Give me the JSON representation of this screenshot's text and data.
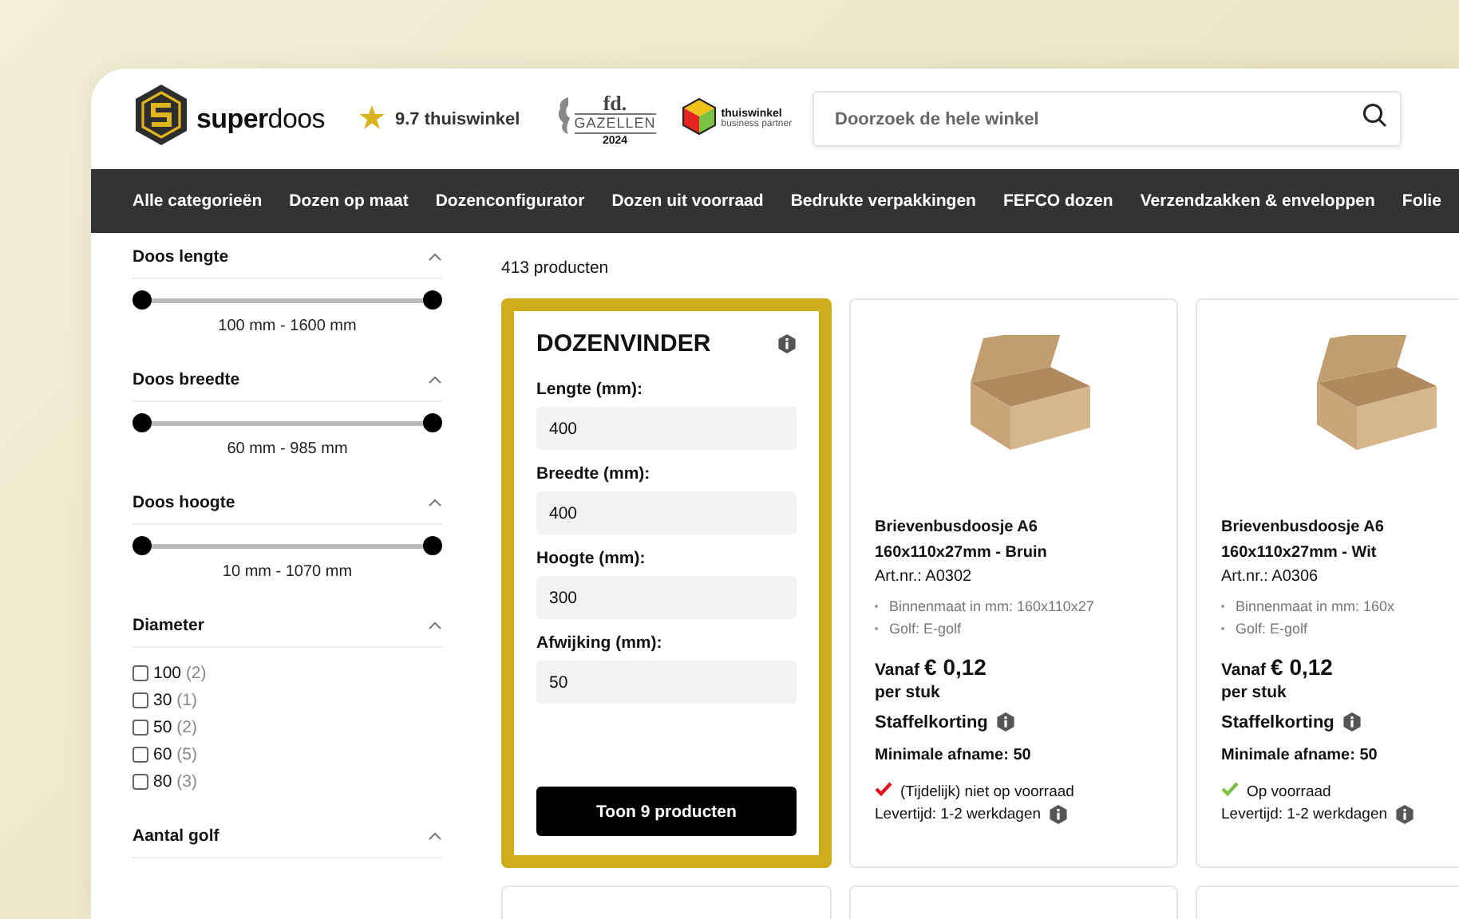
{
  "header": {
    "logo": "**super**doos",
    "rating": "9.7 thuiswinkel",
    "award": {
      "brand": "fd.",
      "title": "GAZELLEN",
      "year": "2024"
    },
    "partner": {
      "name": "thuiswinkel",
      "subtitle": "business partner"
    },
    "search": {
      "placeholder": "Doorzoek de hele winkel"
    }
  },
  "nav": [
    "Alle categorieën",
    "Dozen op maat",
    "Dozenconfigurator",
    "Dozen uit voorraad",
    "Bedrukte verpakkingen",
    "FEFCO dozen",
    "Verzendzakken & enveloppen",
    "Folie"
  ],
  "filters": [
    {
      "kind": "range",
      "title": "Doos lengte",
      "expanded": true,
      "range": "100 mm - 1600 mm",
      "level": 1
    },
    {
      "kind": "range",
      "title": "Doos breedte",
      "expanded": true,
      "range": "60 mm - 985 mm",
      "level": 1
    },
    {
      "kind": "range",
      "title": "Doos hoogte",
      "expanded": true,
      "range": "10 mm - 1070 mm",
      "level": 1
    },
    {
      "kind": "checklist",
      "title": "Diameter",
      "expanded": true,
      "options": [
        {
          "label": "100",
          "count": "(2)",
          "checked": false
        },
        {
          "label": "30",
          "count": "(1)",
          "checked": false
        },
        {
          "label": "50",
          "count": "(2)",
          "checked": false
        },
        {
          "label": "60",
          "count": "(5)",
          "checked": false
        },
        {
          "label": "80",
          "count": "(3)",
          "checked": false
        }
      ]
    },
    {
      "kind": "checklist",
      "title": "Aantal golf",
      "expanded": true
    }
  ],
  "results": {
    "count": "413 producten"
  },
  "finder": {
    "title": "DOZENVINDER",
    "fields": [
      {
        "label": "Lengte (mm):",
        "value": "400"
      },
      {
        "label": "Breedte (mm):",
        "value": "400"
      },
      {
        "label": "Hoogte (mm):",
        "value": "300"
      },
      {
        "label": "Afwijking (mm):",
        "value": "50"
      }
    ],
    "button": "Toon 9 producten"
  },
  "products": [
    {
      "title": "Brievenbusdoosje A6 160x110x27mm - Bruin",
      "sku": "Art.nr.: A0302",
      "specs": [
        "Binnenmaat in mm: 160x110x27",
        "Golf: E-golf"
      ],
      "price_prefix": "Vanaf",
      "price": "€ 0,12",
      "unit": "per stuk",
      "discount": "Staffelkorting",
      "minimum": "Minimale afname: 50",
      "in_stock": false,
      "stock": "(Tijdelijk) niet op voorraad",
      "delivery": "Levertijd: 1-2 werkdagen"
    },
    {
      "title": "Brievenbusdoosje A6 160x110x27mm - Wit",
      "sku": "Art.nr.: A0306",
      "specs": [
        "Binnenmaat in mm: 160x",
        "Golf: E-golf"
      ],
      "price_prefix": "Vanaf",
      "price": "€ 0,12",
      "unit": "per stuk",
      "discount": "Staffelkorting",
      "minimum": "Minimale afname: 50",
      "in_stock": true,
      "stock": "Op voorraad",
      "delivery": "Levertijd: 1-2 werkdagen"
    }
  ]
}
